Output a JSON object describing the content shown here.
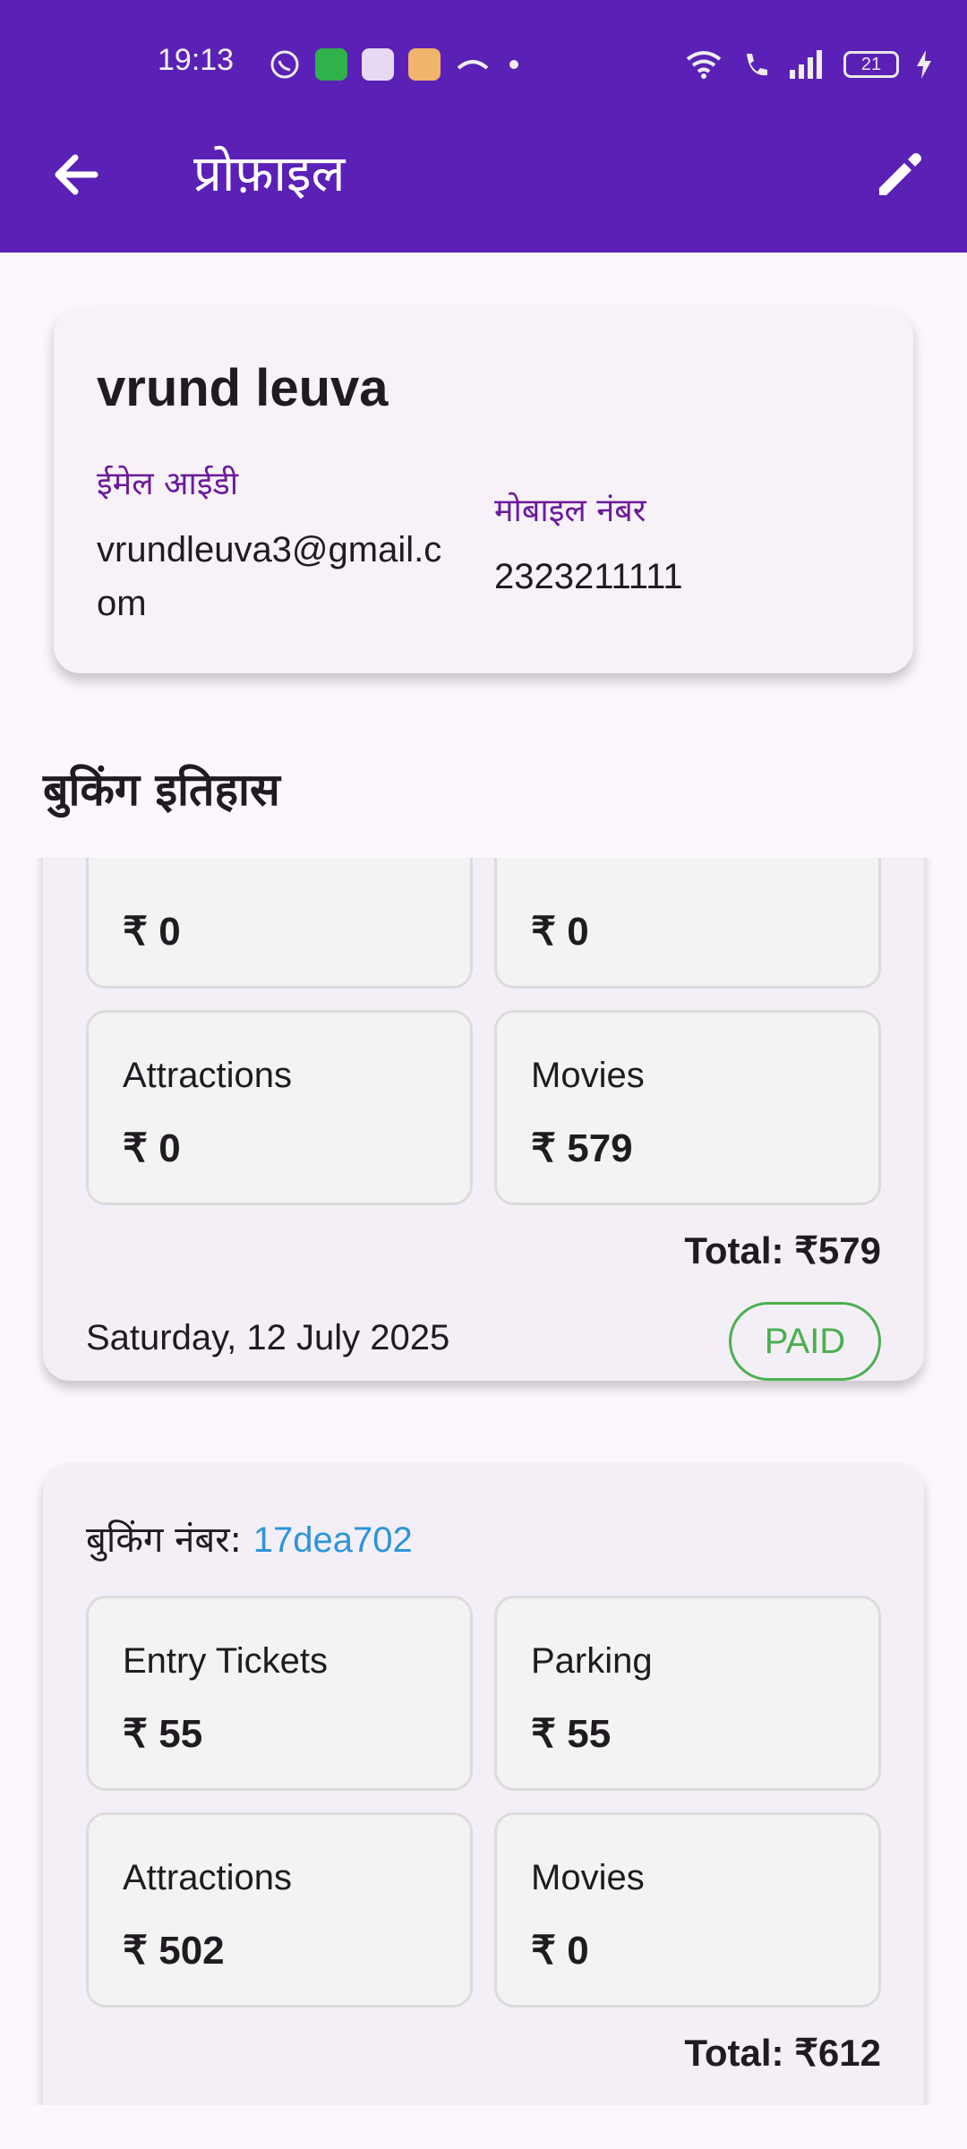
{
  "status_bar": {
    "time": "19:13",
    "battery": "21",
    "notification_icons": [
      "whatsapp-icon",
      "green-app-icon",
      "purple-app-icon",
      "amazon-icon",
      "missed-call-icon",
      "dot-icon"
    ],
    "system_icons": [
      "wifi-icon",
      "wifi-calling-icon",
      "signal-icon",
      "battery-icon",
      "charging-icon"
    ]
  },
  "app_bar": {
    "title": "प्रोफ़ाइल",
    "back_icon": "arrow-back-icon",
    "edit_icon": "edit-pencil-icon",
    "color": "#5b21b6"
  },
  "profile": {
    "name": "vrund leuva",
    "email_label": "ईमेल आईडी",
    "email_line1": "vrundleuva3@gmail.c",
    "email_line2": "om",
    "mobile_label": "मोबाइल नंबर",
    "mobile": "2323211111"
  },
  "history": {
    "title": "बुकिंग इतिहास",
    "bookings": [
      {
        "tiles": [
          {
            "label": "",
            "amount": "₹ 0"
          },
          {
            "label": "",
            "amount": "₹ 0"
          },
          {
            "label": "Attractions",
            "amount": "₹ 0"
          },
          {
            "label": "Movies",
            "amount": "₹ 579"
          }
        ],
        "total": "Total: ₹579",
        "date": "Saturday, 12 July 2025",
        "status": "PAID"
      },
      {
        "number_label": "बुकिंग नंबर: ",
        "number": "17dea702",
        "tiles": [
          {
            "label": "Entry Tickets",
            "amount": "₹ 55"
          },
          {
            "label": "Parking",
            "amount": "₹ 55"
          },
          {
            "label": "Attractions",
            "amount": "₹ 502"
          },
          {
            "label": "Movies",
            "amount": "₹ 0"
          }
        ],
        "total": "Total: ₹612"
      }
    ]
  },
  "colors": {
    "accent": "#5b21b6",
    "label": "#6a1b9a",
    "link": "#2c95db",
    "paid": "#4caf50"
  }
}
